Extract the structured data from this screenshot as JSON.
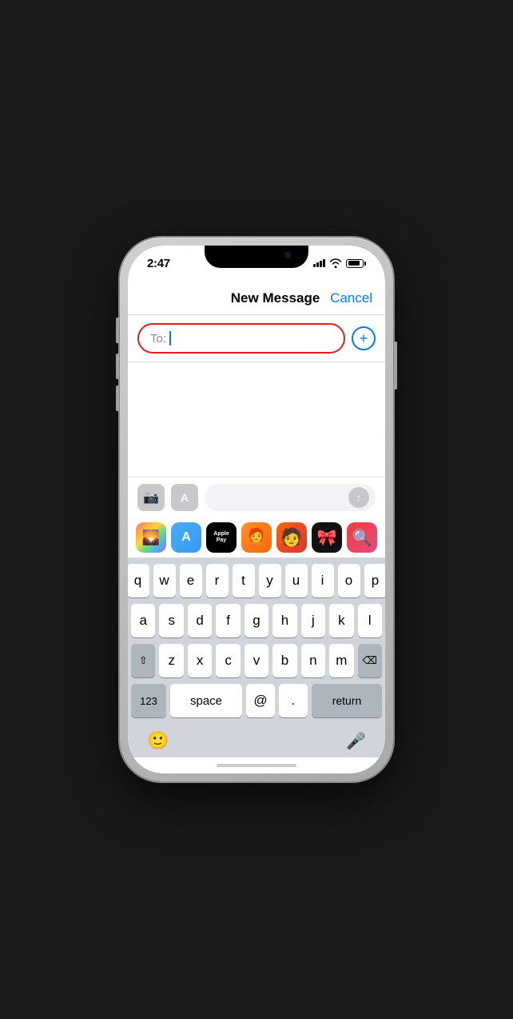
{
  "status_bar": {
    "time": "2:47",
    "signal_bars": [
      3,
      5,
      7,
      9,
      11
    ],
    "battery_level": 85
  },
  "header": {
    "title": "New Message",
    "cancel_label": "Cancel"
  },
  "to_field": {
    "label": "To:",
    "placeholder": ""
  },
  "add_contact": {
    "icon": "+"
  },
  "toolbar": {
    "camera_icon": "📷",
    "appstore_icon": "A",
    "send_icon": "↑"
  },
  "app_icons": [
    {
      "name": "Photos",
      "emoji": "🌈"
    },
    {
      "name": "App Store",
      "emoji": "A"
    },
    {
      "name": "Apple Pay",
      "text": "Apple Pay"
    },
    {
      "name": "Memoji 1",
      "emoji": "🧑‍🦰"
    },
    {
      "name": "Memoji 2",
      "emoji": "🧑"
    },
    {
      "name": "Heart",
      "emoji": "❤️"
    },
    {
      "name": "Search",
      "emoji": "🔍"
    }
  ],
  "keyboard": {
    "rows": [
      [
        "q",
        "w",
        "e",
        "r",
        "t",
        "y",
        "u",
        "i",
        "o",
        "p"
      ],
      [
        "a",
        "s",
        "d",
        "f",
        "g",
        "h",
        "j",
        "k",
        "l"
      ],
      [
        "z",
        "x",
        "c",
        "v",
        "b",
        "n",
        "m"
      ]
    ],
    "special": {
      "shift": "⇧",
      "delete": "⌫",
      "numbers": "123",
      "space": "space",
      "at": "@",
      "dot": ".",
      "return": "return"
    }
  }
}
